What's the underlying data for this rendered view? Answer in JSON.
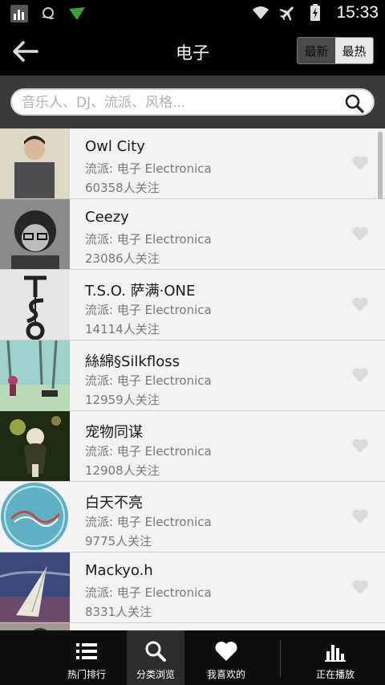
{
  "status_bar": {
    "time": "15:33"
  },
  "header": {
    "title": "电子",
    "sort_options": [
      "最新",
      "最热"
    ],
    "active_sort": "最热"
  },
  "search": {
    "placeholder": "音乐人、DJ、流派、风格..."
  },
  "artists": [
    {
      "name": "Owl City",
      "genre": "流派: 电子 Electronica",
      "followers": "60358人关注"
    },
    {
      "name": "Ceezy",
      "genre": "流派: 电子 Electronica",
      "followers": "23086人关注"
    },
    {
      "name": "T.S.O. 萨满·ONE",
      "genre": "流派: 电子 Electronica",
      "followers": "14114人关注"
    },
    {
      "name": "絲綿§Silkfloss",
      "genre": "流派: 电子 Electronica",
      "followers": "12959人关注"
    },
    {
      "name": "宠物同谋",
      "genre": "流派: 电子 Electronica",
      "followers": "12908人关注"
    },
    {
      "name": "白天不亮",
      "genre": "流派: 电子 Electronica",
      "followers": "9775人关注"
    },
    {
      "name": "Mackyo.h",
      "genre": "流派: 电子 Electronica",
      "followers": "8331人关注"
    }
  ],
  "bottom_nav": {
    "items": [
      {
        "label": "热门排行",
        "icon": "list-icon"
      },
      {
        "label": "分类浏览",
        "icon": "search-icon"
      },
      {
        "label": "我喜欢的",
        "icon": "heart-icon"
      },
      {
        "label": "正在播放",
        "icon": "equalizer-icon"
      }
    ],
    "active_index": 1
  },
  "colors": {
    "header_bg": "#000000",
    "search_bg": "#3a3a3a",
    "list_bg": "#f2f2f2",
    "nav_bg": "#0e0e0e"
  }
}
